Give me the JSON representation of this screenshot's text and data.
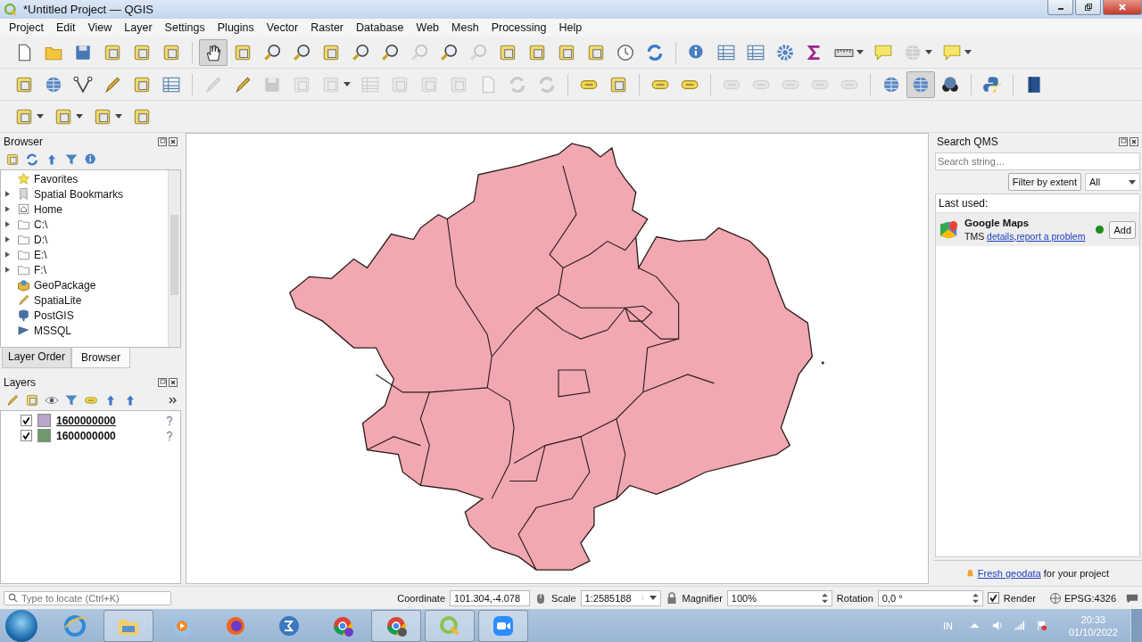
{
  "window": {
    "title": "*Untitled Project — QGIS"
  },
  "menu": [
    "Project",
    "Edit",
    "View",
    "Layer",
    "Settings",
    "Plugins",
    "Vector",
    "Raster",
    "Database",
    "Web",
    "Mesh",
    "Processing",
    "Help"
  ],
  "toolbars": [
    [
      {
        "disabled": false,
        "pressed": false,
        "dropdown": false
      },
      {
        "disabled": false,
        "pressed": false,
        "dropdown": false
      },
      {
        "disabled": false,
        "pressed": false,
        "dropdown": false
      },
      {
        "disabled": false,
        "pressed": false,
        "dropdown": false
      },
      {
        "disabled": false,
        "pressed": false,
        "dropdown": false
      },
      {
        "disabled": false,
        "pressed": false,
        "dropdown": false
      },
      {
        "disabled": false,
        "pressed": true,
        "dropdown": false
      },
      {
        "disabled": false,
        "pressed": false,
        "dropdown": false
      },
      {
        "disabled": false,
        "pressed": false,
        "dropdown": false
      },
      {
        "disabled": false,
        "pressed": false,
        "dropdown": false
      },
      {
        "disabled": false,
        "pressed": false,
        "dropdown": false
      },
      {
        "disabled": false,
        "pressed": false,
        "dropdown": false
      },
      {
        "disabled": false,
        "pressed": false,
        "dropdown": false
      },
      {
        "disabled": true,
        "pressed": false,
        "dropdown": false
      },
      {
        "disabled": false,
        "pressed": false,
        "dropdown": false
      },
      {
        "disabled": true,
        "pressed": false,
        "dropdown": false
      },
      {
        "disabled": false,
        "pressed": false,
        "dropdown": false
      },
      {
        "disabled": false,
        "pressed": false,
        "dropdown": false
      },
      {
        "disabled": false,
        "pressed": false,
        "dropdown": false
      },
      {
        "disabled": false,
        "pressed": false,
        "dropdown": false
      },
      {
        "disabled": false,
        "pressed": false,
        "dropdown": false
      },
      {
        "disabled": false,
        "pressed": false,
        "dropdown": false
      },
      {
        "disabled": false,
        "pressed": false,
        "dropdown": false
      },
      {
        "disabled": false,
        "pressed": false,
        "dropdown": false
      },
      {
        "disabled": false,
        "pressed": false,
        "dropdown": false
      },
      {
        "disabled": false,
        "pressed": false,
        "dropdown": false
      },
      {
        "disabled": false,
        "pressed": false,
        "dropdown": false
      },
      {
        "disabled": false,
        "pressed": false,
        "dropdown": true
      },
      {
        "disabled": false,
        "pressed": false,
        "dropdown": false
      },
      {
        "disabled": true,
        "pressed": false,
        "dropdown": true
      },
      {
        "disabled": false,
        "pressed": false,
        "dropdown": true
      }
    ],
    [
      {
        "disabled": false,
        "pressed": false,
        "dropdown": false
      },
      {
        "disabled": false,
        "pressed": false,
        "dropdown": false
      },
      {
        "disabled": false,
        "pressed": false,
        "dropdown": false
      },
      {
        "disabled": false,
        "pressed": false,
        "dropdown": false
      },
      {
        "disabled": false,
        "pressed": false,
        "dropdown": false
      },
      {
        "disabled": false,
        "pressed": false,
        "dropdown": false
      },
      {
        "disabled": true,
        "pressed": false,
        "dropdown": false
      },
      {
        "disabled": false,
        "pressed": false,
        "dropdown": false
      },
      {
        "disabled": true,
        "pressed": false,
        "dropdown": false
      },
      {
        "disabled": true,
        "pressed": false,
        "dropdown": false
      },
      {
        "disabled": true,
        "pressed": false,
        "dropdown": true
      },
      {
        "disabled": true,
        "pressed": false,
        "dropdown": false
      },
      {
        "disabled": true,
        "pressed": false,
        "dropdown": false
      },
      {
        "disabled": true,
        "pressed": false,
        "dropdown": false
      },
      {
        "disabled": true,
        "pressed": false,
        "dropdown": false
      },
      {
        "disabled": true,
        "pressed": false,
        "dropdown": false
      },
      {
        "disabled": true,
        "pressed": false,
        "dropdown": false
      },
      {
        "disabled": true,
        "pressed": false,
        "dropdown": false
      },
      {
        "disabled": false,
        "pressed": false,
        "dropdown": false
      },
      {
        "disabled": false,
        "pressed": false,
        "dropdown": false
      },
      {
        "disabled": false,
        "pressed": false,
        "dropdown": false
      },
      {
        "disabled": false,
        "pressed": false,
        "dropdown": false
      },
      {
        "disabled": true,
        "pressed": false,
        "dropdown": false
      },
      {
        "disabled": true,
        "pressed": false,
        "dropdown": false
      },
      {
        "disabled": true,
        "pressed": false,
        "dropdown": false
      },
      {
        "disabled": true,
        "pressed": false,
        "dropdown": false
      },
      {
        "disabled": true,
        "pressed": false,
        "dropdown": false
      },
      {
        "disabled": false,
        "pressed": false,
        "dropdown": false
      },
      {
        "disabled": false,
        "pressed": true,
        "dropdown": false
      },
      {
        "disabled": false,
        "pressed": false,
        "dropdown": false
      },
      {
        "disabled": false,
        "pressed": false,
        "dropdown": false
      },
      {
        "disabled": false,
        "pressed": false,
        "dropdown": false
      }
    ],
    [
      {
        "disabled": false,
        "pressed": false,
        "dropdown": true
      },
      {
        "disabled": false,
        "pressed": false,
        "dropdown": true
      },
      {
        "disabled": false,
        "pressed": false,
        "dropdown": true
      },
      {
        "disabled": false,
        "pressed": false,
        "dropdown": false
      }
    ]
  ],
  "browser": {
    "title": "Browser",
    "items": [
      {
        "label": "Favorites",
        "has_children": false
      },
      {
        "label": "Spatial Bookmarks",
        "has_children": true
      },
      {
        "label": "Home",
        "has_children": true
      },
      {
        "label": "C:\\",
        "has_children": true
      },
      {
        "label": "D:\\",
        "has_children": true
      },
      {
        "label": "E:\\",
        "has_children": true
      },
      {
        "label": "F:\\",
        "has_children": true
      },
      {
        "label": "GeoPackage",
        "has_children": false
      },
      {
        "label": "SpatiaLite",
        "has_children": false
      },
      {
        "label": "PostGIS",
        "has_children": false
      },
      {
        "label": "MSSQL",
        "has_children": false
      }
    ]
  },
  "dock_tabs": [
    {
      "label": "Layer Order",
      "selected": false
    },
    {
      "label": "Browser",
      "selected": true
    }
  ],
  "layers": {
    "title": "Layers",
    "items": [
      {
        "name": "1600000000",
        "checked": true,
        "color": "#b9a5c8",
        "selected": true
      },
      {
        "name": "1600000000",
        "checked": true,
        "color": "#6e9a6a",
        "selected": false
      }
    ]
  },
  "qms": {
    "title": "Search QMS",
    "search": {
      "placeholder": "Search string…"
    },
    "filter_button": "Filter by extent",
    "filter_select": "All",
    "last_used": "Last used:",
    "services": [
      {
        "name": "Google Maps",
        "type": "TMS",
        "links": [
          {
            "label": "details",
            "suffix": ","
          },
          {
            "label": "report a problem"
          }
        ],
        "color": "#1e8c1e",
        "button": "Add"
      }
    ],
    "footer": {
      "link": "Fresh geodata",
      "text": "for your project"
    }
  },
  "status_bar": {
    "locate_placeholder": "Type to locate (Ctrl+K)",
    "coordinate_label": "Coordinate",
    "coordinate": "101.304,-4.078",
    "scale_label": "Scale",
    "scale": "1:2585188",
    "magnifier_label": "Magnifier",
    "magnifier": "100%",
    "rotation_label": "Rotation",
    "rotation": "0,0 °",
    "render": {
      "label": "Render",
      "checked": true
    },
    "crs": "EPSG:4326"
  },
  "taskbar": {
    "apps": [
      {
        "active": false
      },
      {
        "active": true
      },
      {
        "active": false
      },
      {
        "active": false
      },
      {
        "active": false
      },
      {
        "active": false
      },
      {
        "active": true
      },
      {
        "active": true
      },
      {
        "active": true
      }
    ],
    "language": "IN",
    "time": "20:33",
    "date": "01/10/2022"
  }
}
